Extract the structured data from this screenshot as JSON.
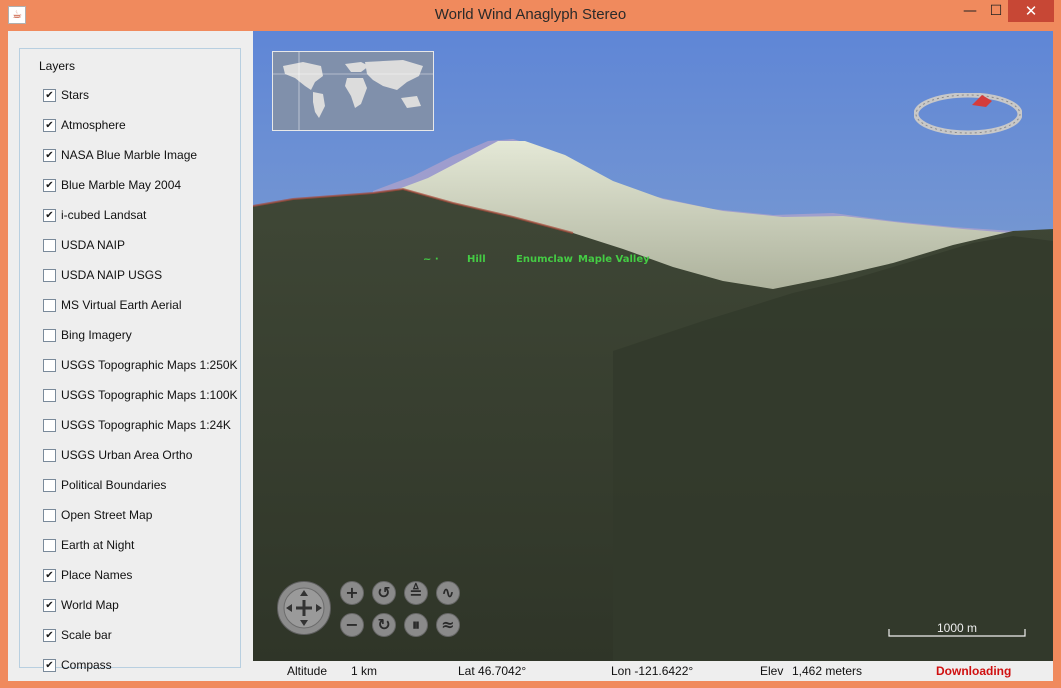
{
  "window": {
    "title": "World Wind Anaglyph Stereo",
    "minimize_glyph": "—",
    "maximize_glyph": "☐",
    "close_glyph": "✕"
  },
  "layers_panel": {
    "title": "Layers",
    "items": [
      {
        "label": "Stars",
        "checked": true
      },
      {
        "label": "Atmosphere",
        "checked": true
      },
      {
        "label": "NASA Blue Marble Image",
        "checked": true
      },
      {
        "label": "Blue Marble May 2004",
        "checked": true
      },
      {
        "label": "i-cubed Landsat",
        "checked": true
      },
      {
        "label": "USDA NAIP",
        "checked": false
      },
      {
        "label": "USDA NAIP USGS",
        "checked": false
      },
      {
        "label": "MS Virtual Earth Aerial",
        "checked": false
      },
      {
        "label": "Bing Imagery",
        "checked": false
      },
      {
        "label": "USGS Topographic Maps 1:250K",
        "checked": false
      },
      {
        "label": "USGS Topographic Maps 1:100K",
        "checked": false
      },
      {
        "label": "USGS Topographic Maps 1:24K",
        "checked": false
      },
      {
        "label": "USGS Urban Area Ortho",
        "checked": false
      },
      {
        "label": "Political Boundaries",
        "checked": false
      },
      {
        "label": "Open Street Map",
        "checked": false
      },
      {
        "label": "Earth at Night",
        "checked": false
      },
      {
        "label": "Place Names",
        "checked": true
      },
      {
        "label": "World Map",
        "checked": true
      },
      {
        "label": "Scale bar",
        "checked": true
      },
      {
        "label": "Compass",
        "checked": true
      }
    ]
  },
  "globe": {
    "place_names": [
      "Hill",
      "Enumclaw",
      "Maple Valley"
    ],
    "scale_label": "1000 m",
    "nav_icons": [
      "pan-icon",
      "zoom-in-icon",
      "zoom-out-icon",
      "rotate-left-icon",
      "rotate-right-icon",
      "tilt-up-icon",
      "tilt-down-icon",
      "exaggeration-up-icon",
      "exaggeration-down-icon"
    ]
  },
  "status": {
    "altitude_label": "Altitude",
    "altitude_value": "1 km",
    "lat": "Lat 46.7042°",
    "lon": "Lon -121.6422°",
    "elev_label": "Elev",
    "elev_value": "1,462 meters",
    "downloading": "Downloading"
  },
  "colors": {
    "title_bar": "#f08a5d",
    "close_button": "#c74735",
    "place_name": "#44cc44",
    "downloading": "#d01010",
    "sky": "#6d8ed0",
    "terrain": "#3b4230"
  }
}
